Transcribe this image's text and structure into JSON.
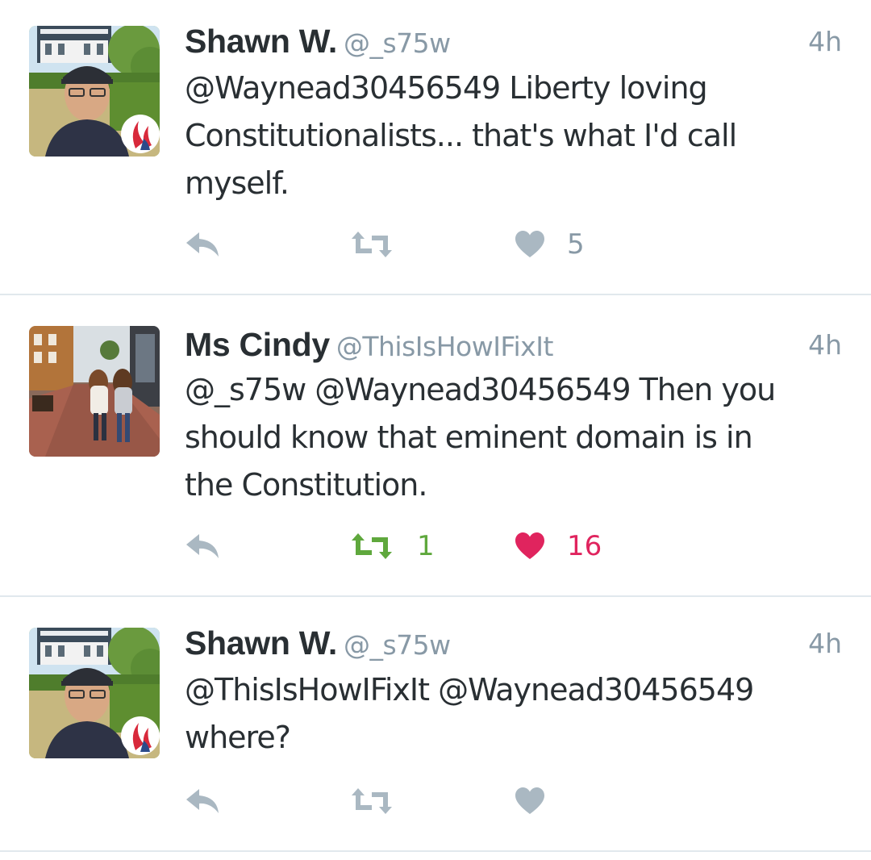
{
  "colors": {
    "icon_default": "#aab8c2",
    "retweeted": "#5fa83d",
    "liked": "#e0245e",
    "meta_text": "#8899a6",
    "divider": "#e1e8ed"
  },
  "tweets": [
    {
      "name": "Shawn W.",
      "handle": "@_s75w",
      "time": "4h",
      "lines": [
        "@Waynead30456549 Liberty loving",
        "Constitutionalists... that's what I'd call",
        "myself."
      ],
      "reply_icon": "reply-arrow-icon",
      "retweet_icon": "retweet-icon",
      "retweet_count": "",
      "like_icon": "heart-icon",
      "like_count": "5",
      "retweeted": false,
      "liked": false
    },
    {
      "name": "Ms Cindy",
      "handle": "@ThisIsHowIFixIt",
      "time": "4h",
      "lines": [
        "@_s75w @Waynead30456549 Then you",
        "should know that eminent domain is in",
        "the Constitution."
      ],
      "reply_icon": "reply-arrow-icon",
      "retweet_icon": "retweet-icon",
      "retweet_count": "1",
      "like_icon": "heart-icon",
      "like_count": "16",
      "retweeted": true,
      "liked": true
    },
    {
      "name": "Shawn W.",
      "handle": "@_s75w",
      "time": "4h",
      "lines": [
        "@ThisIsHowIFixIt @Waynead30456549",
        "where?"
      ],
      "reply_icon": "reply-arrow-icon",
      "retweet_icon": "retweet-icon",
      "retweet_count": "",
      "like_icon": "heart-icon",
      "like_count": "",
      "retweeted": false,
      "liked": false
    }
  ]
}
